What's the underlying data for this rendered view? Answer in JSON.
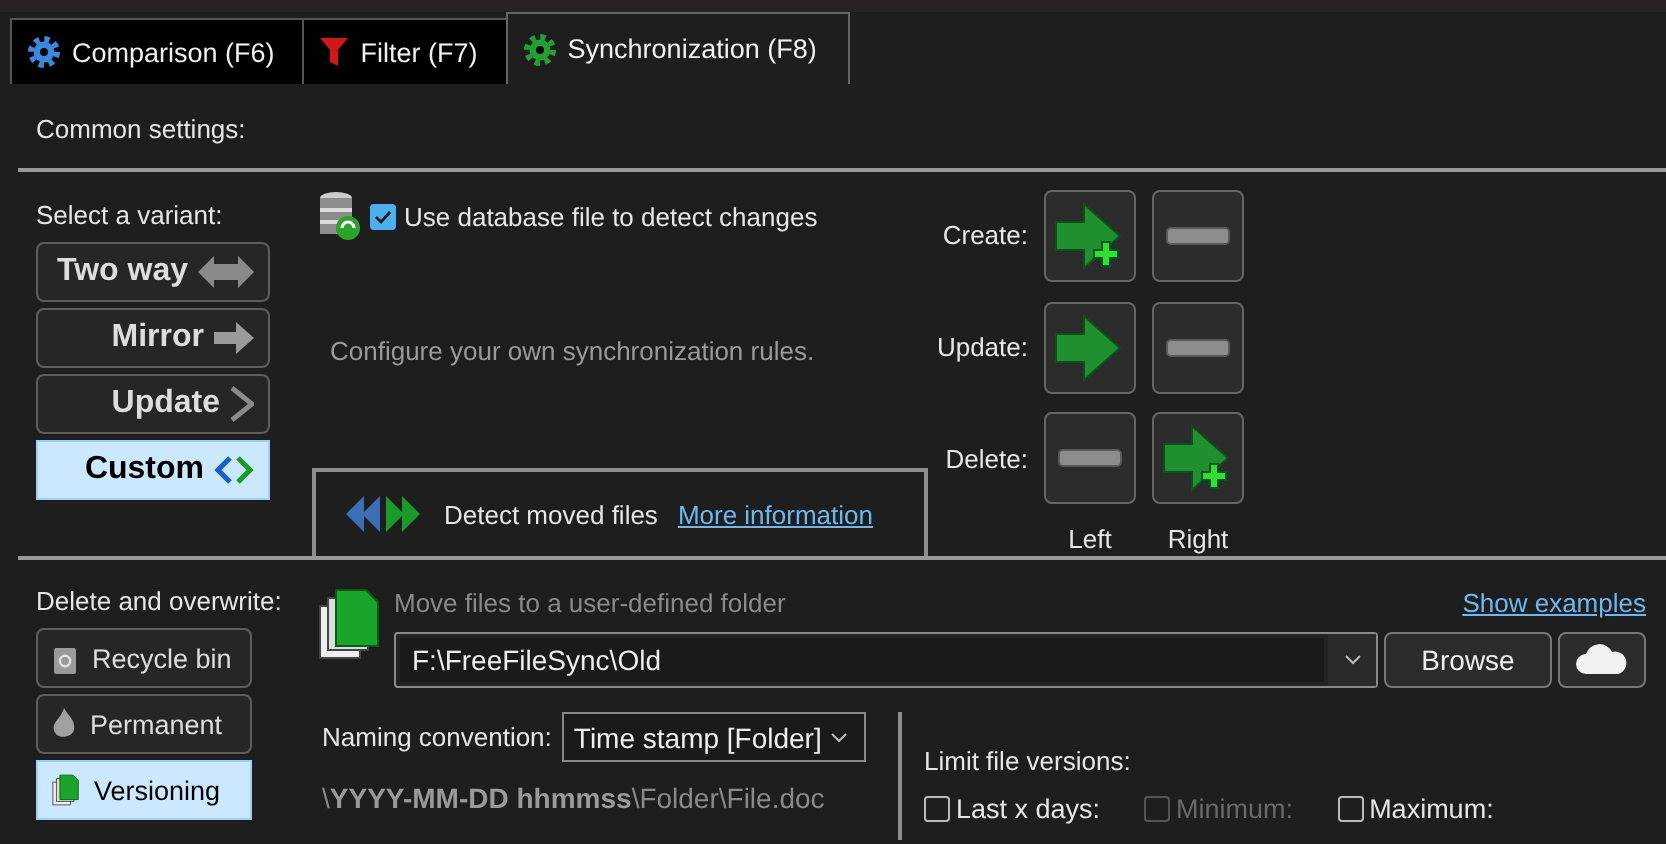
{
  "tabs": [
    {
      "label": "Comparison (F6)",
      "selected": false
    },
    {
      "label": "Filter (F7)",
      "selected": false
    },
    {
      "label": "Synchronization (F8)",
      "selected": true
    }
  ],
  "common_settings": "Common settings:",
  "variants": {
    "label": "Select a variant:",
    "options": [
      {
        "label": "Two way",
        "selected": false
      },
      {
        "label": "Mirror",
        "selected": false
      },
      {
        "label": "Update",
        "selected": false
      },
      {
        "label": "Custom",
        "selected": true
      }
    ]
  },
  "database": {
    "label": "Use database file to detect changes",
    "checked": true
  },
  "description": "Configure your own synchronization rules.",
  "detect_moved": {
    "label": "Detect moved files",
    "link": "More information"
  },
  "directions": {
    "rows": [
      {
        "label": "Create:",
        "cells": [
          {
            "kind": "copy_new"
          },
          {
            "kind": "none"
          }
        ]
      },
      {
        "label": "Update:",
        "cells": [
          {
            "kind": "overwrite"
          },
          {
            "kind": "none"
          }
        ]
      },
      {
        "label": "Delete:",
        "cells": [
          {
            "kind": "none"
          },
          {
            "kind": "copy_new"
          }
        ]
      }
    ],
    "columns": [
      "Left",
      "Right"
    ]
  },
  "deletion": {
    "label": "Delete and overwrite:",
    "options": [
      {
        "label": "Recycle bin",
        "selected": false
      },
      {
        "label": "Permanent",
        "selected": false
      },
      {
        "label": "Versioning",
        "selected": true
      }
    ]
  },
  "versioning": {
    "hint": "Move files to a user-defined folder",
    "link": "Show examples",
    "folder": "F:\\FreeFileSync\\Old",
    "browse": "Browse",
    "naming_label": "Naming convention:",
    "naming_value": "Time stamp [Folder]",
    "example": "\\**YYYY-MM-DD hhmmss**\\Folder\\File.doc"
  },
  "limits": {
    "label": "Limit file versions:",
    "options": [
      {
        "label": "Last x days:",
        "checked": false,
        "disabled": false
      },
      {
        "label": "Minimum:",
        "checked": false,
        "disabled": true
      },
      {
        "label": "Maximum:",
        "checked": false,
        "disabled": false
      }
    ]
  }
}
